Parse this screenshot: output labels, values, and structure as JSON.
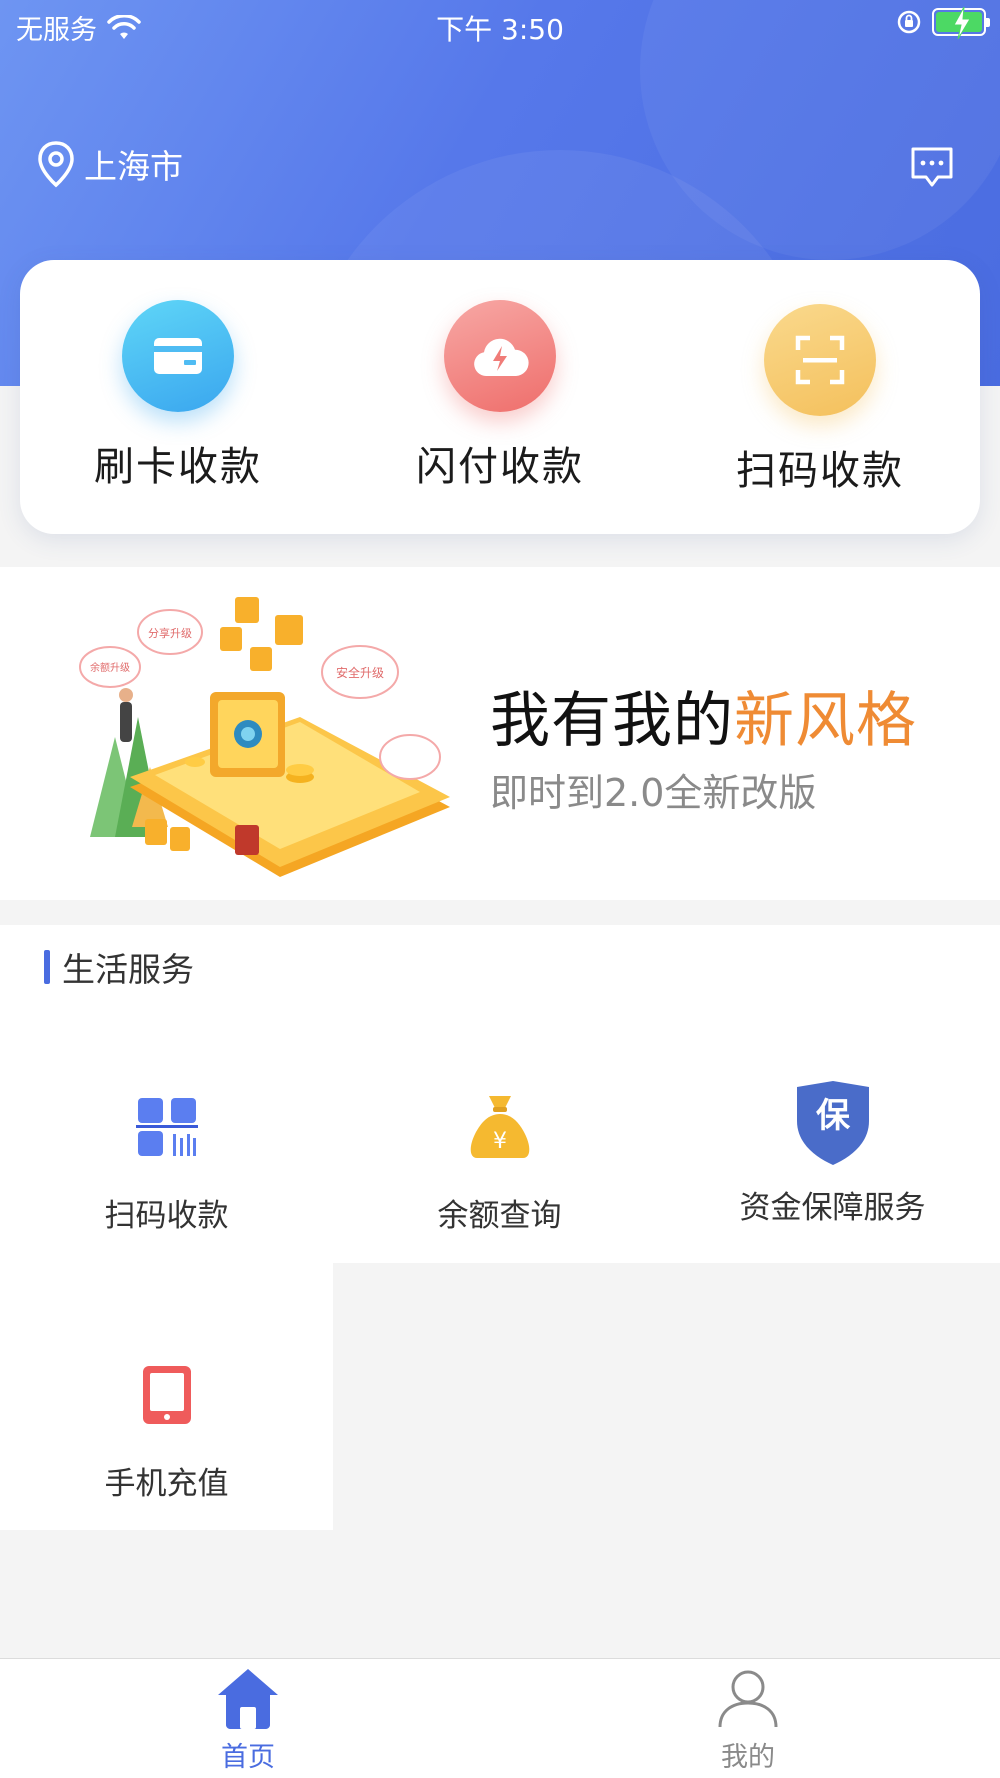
{
  "status_bar": {
    "carrier": "无服务",
    "time": "下午 3:50"
  },
  "header": {
    "location": "上海市"
  },
  "quick_actions": [
    {
      "label": "刷卡收款",
      "icon": "card-icon"
    },
    {
      "label": "闪付收款",
      "icon": "cloud-flash-icon"
    },
    {
      "label": "扫码收款",
      "icon": "scan-icon"
    }
  ],
  "banner": {
    "title_prefix": "我有我的",
    "title_highlight": "新风格",
    "subtitle": "即时到2.0全新改版",
    "art_labels": [
      "分享升级",
      "安全升级",
      "余额升级"
    ]
  },
  "life_services": {
    "title": "生活服务",
    "items": [
      {
        "label": "扫码收款",
        "icon": "qr-code-icon"
      },
      {
        "label": "余额查询",
        "icon": "money-bag-icon"
      },
      {
        "label": "资金保障服务",
        "icon": "shield-icon",
        "badge": "保"
      },
      {
        "label": "手机充值",
        "icon": "phone-icon"
      }
    ]
  },
  "tab_bar": {
    "tabs": [
      {
        "label": "首页",
        "icon": "home-icon",
        "active": true
      },
      {
        "label": "我的",
        "icon": "user-icon",
        "active": false
      }
    ]
  },
  "colors": {
    "primary": "#4a6ce0",
    "highlight": "#ef8b34",
    "battery": "#4cd964"
  }
}
